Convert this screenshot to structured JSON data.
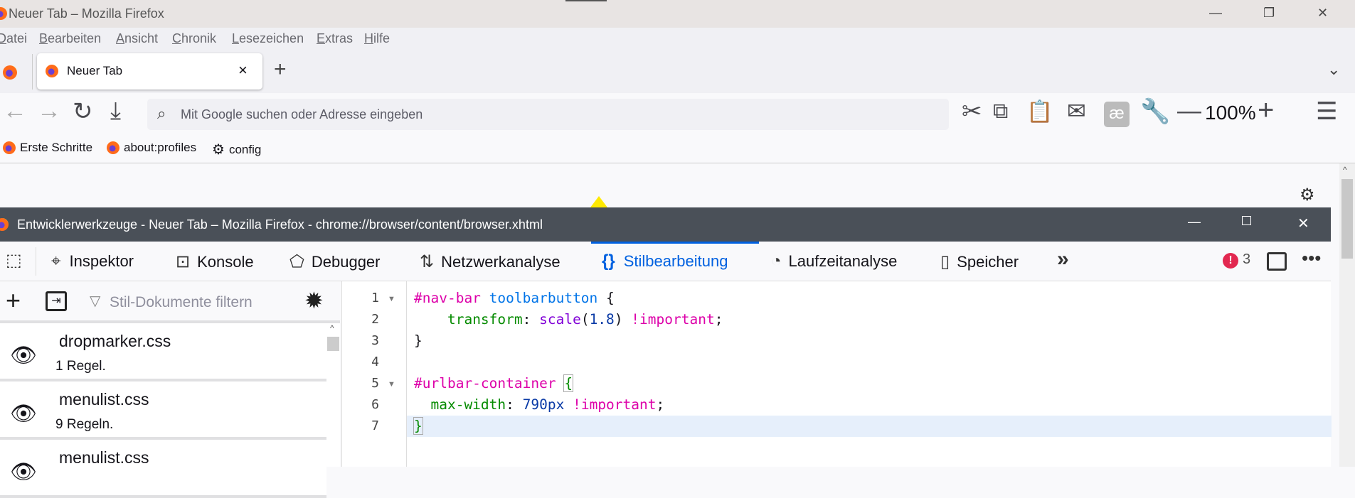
{
  "window": {
    "title": "Neuer Tab – Mozilla Firefox"
  },
  "menubar": [
    "Datei",
    "Bearbeiten",
    "Ansicht",
    "Chronik",
    "Lesezeichen",
    "Extras",
    "Hilfe"
  ],
  "tab": {
    "label": "Neuer Tab",
    "close": "×",
    "new": "+"
  },
  "urlbar": {
    "placeholder": "Mit Google suchen oder Adresse eingeben"
  },
  "zoom": {
    "value": "100%"
  },
  "bookmarks": [
    "Erste Schritte",
    "about:profiles",
    "config"
  ],
  "devtools": {
    "title": "Entwicklerwerkzeuge - Neuer Tab – Mozilla Firefox - chrome://browser/content/browser.xhtml",
    "tools": [
      "Inspektor",
      "Konsole",
      "Debugger",
      "Netzwerkanalyse",
      "Stilbearbeitung",
      "Laufzeitanalyse",
      "Speicher"
    ],
    "error_count": "3",
    "filter_placeholder": "Stil-Dokumente filtern",
    "sheets": [
      {
        "name": "dropmarker.css",
        "rules": "1 Regel."
      },
      {
        "name": "menulist.css",
        "rules": "9 Regeln."
      },
      {
        "name": "menulist.css",
        "rules": ""
      }
    ],
    "lines": [
      "1",
      "2",
      "3",
      "4",
      "5",
      "6",
      "7"
    ]
  },
  "colors": {
    "accent": "#0061e0",
    "error": "#e22850",
    "devtools_title": "#4a5058"
  }
}
